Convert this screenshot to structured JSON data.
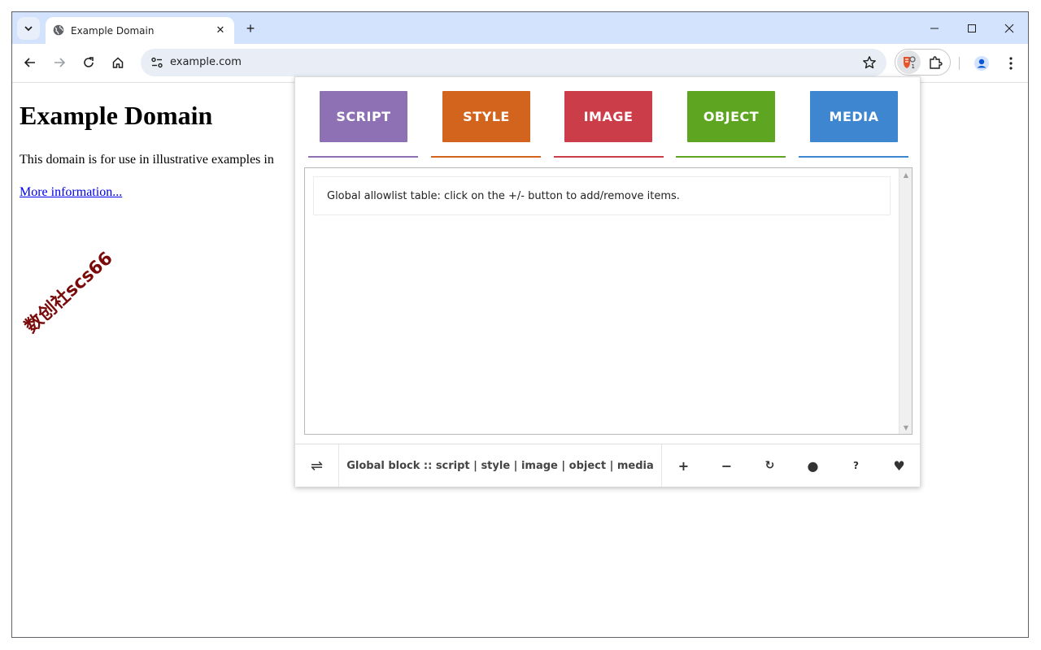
{
  "browser": {
    "tab_title": "Example Domain",
    "url": "example.com",
    "extension_badge": "1",
    "icons": {
      "tab_search": "chevron-down-icon",
      "favicon": "globe-icon",
      "tab_close": "close-icon",
      "new_tab": "plus-icon",
      "minimize": "minimize-icon",
      "maximize": "maximize-icon",
      "close_window": "close-icon",
      "back": "arrow-left-icon",
      "forward": "arrow-right-icon",
      "reload": "reload-icon",
      "home": "home-icon",
      "site_info": "tune-icon",
      "bookmark": "star-icon",
      "extension": "shield-icon",
      "extensions_menu": "puzzle-icon",
      "profile": "person-icon",
      "menu": "kebab-icon"
    },
    "tab_close_glyph": "✕",
    "new_tab_glyph": "+"
  },
  "page": {
    "heading": "Example Domain",
    "paragraph": "This domain is for use in illustrative examples in",
    "link": "More information..."
  },
  "watermark": "数创社scs66",
  "popup": {
    "categories": [
      {
        "label": "SCRIPT",
        "color": "#8e70b4"
      },
      {
        "label": "STYLE",
        "color": "#d2641e"
      },
      {
        "label": "IMAGE",
        "color": "#cc3d4a"
      },
      {
        "label": "OBJECT",
        "color": "#5ea522"
      },
      {
        "label": "MEDIA",
        "color": "#3f86d0"
      }
    ],
    "info": "Global allowlist table: click on the +/- button to add/remove items.",
    "footer": {
      "swap_glyph": "⇌",
      "global_block": "Global block :: script | style | image | object | media",
      "actions": [
        {
          "name": "add",
          "glyph": "+"
        },
        {
          "name": "remove",
          "glyph": "−"
        },
        {
          "name": "reload",
          "glyph": "↻"
        },
        {
          "name": "record",
          "glyph": "●"
        },
        {
          "name": "help",
          "glyph": "?"
        },
        {
          "name": "donate",
          "glyph": "♥"
        }
      ]
    }
  }
}
